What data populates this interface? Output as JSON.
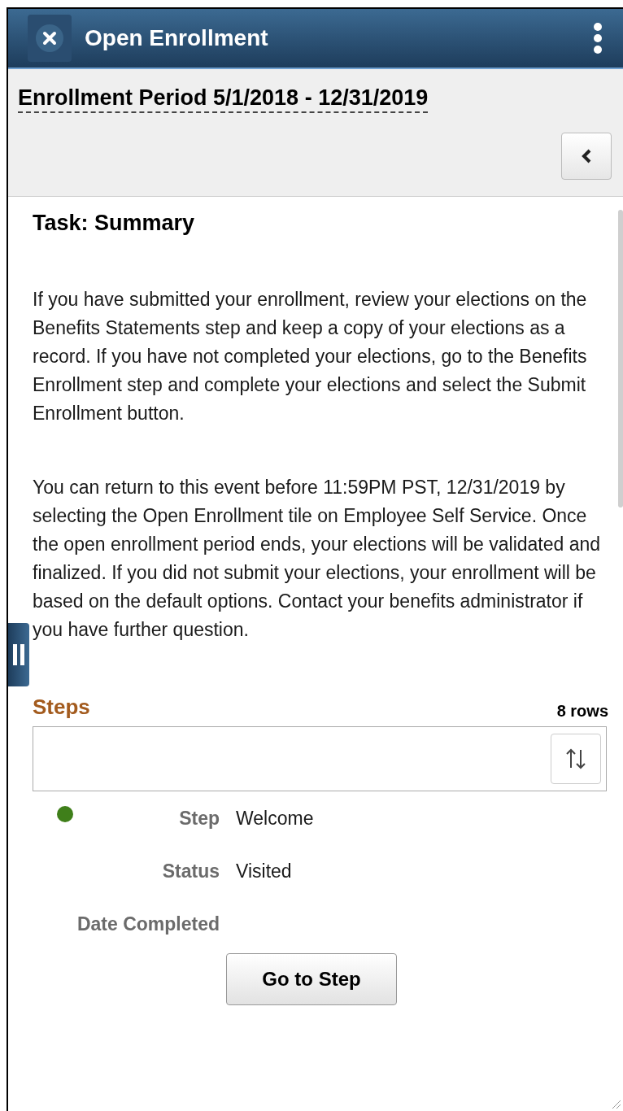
{
  "header": {
    "title": "Open Enrollment"
  },
  "period": {
    "title": "Enrollment Period 5/1/2018 - 12/31/2019"
  },
  "task": {
    "title": "Task: Summary",
    "paragraphs": [
      "If you have submitted your enrollment, review your elections on the Benefits Statements step and keep a copy of your elections as a record. If you have not completed your elections, go to the Benefits Enrollment step and complete your elections and select the Submit Enrollment button.",
      "You can return to this event before 11:59PM PST, 12/31/2019 by selecting the Open Enrollment tile on Employee Self Service. Once the open enrollment period ends, your elections will be validated and finalized. If you did not submit your elections, your enrollment will be based on the default options.  Contact your benefits administrator if you have further question."
    ]
  },
  "steps": {
    "title": "Steps",
    "count": "8 rows",
    "rows": [
      {
        "color": "#3f7f1a",
        "fields": [
          {
            "label": "Step",
            "value": "Welcome"
          },
          {
            "label": "Status",
            "value": "Visited"
          },
          {
            "label": "Date Completed"
          }
        ],
        "button": "Go to Step"
      }
    ]
  }
}
